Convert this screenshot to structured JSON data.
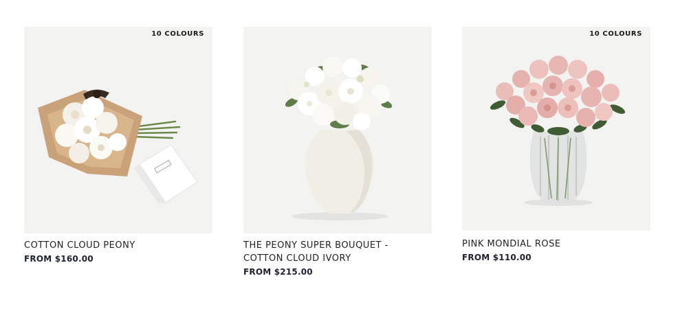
{
  "products": [
    {
      "badge": "10 COLOURS",
      "title": "COTTON CLOUD PEONY",
      "price": "FROM $160.00",
      "image_icon": "wrapped-bouquet-with-card-image"
    },
    {
      "badge": "",
      "title": "THE PEONY SUPER BOUQUET - COTTON CLOUD IVORY",
      "price": "FROM $215.00",
      "image_icon": "white-peonies-in-vase-image"
    },
    {
      "badge": "10 COLOURS",
      "title": "PINK MONDIAL ROSE",
      "price": "FROM $110.00",
      "image_icon": "pink-roses-in-glass-vase-image"
    }
  ],
  "colors": {
    "image_background": "#f3f3f2",
    "price_text": "#1d2230",
    "rose_pink": "#e8b7b4",
    "kraft_paper": "#c9a27a"
  }
}
